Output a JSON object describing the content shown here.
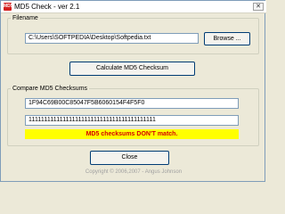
{
  "window": {
    "title": "MD5 Check - ver 2.1",
    "icon_label": "MD5",
    "close_glyph": "✕"
  },
  "filename_group": {
    "legend": "Filename",
    "path_value": "C:\\Users\\SOFTPEDIA\\Desktop\\Softpedia.txt",
    "browse_label": "Browse ..."
  },
  "calculate_label": "Calculate MD5 Checksum",
  "compare_group": {
    "legend": "Compare MD5 Checksums",
    "computed_hash": "1F94C69B00C85047F5B6060154F4F5F0",
    "compare_value": "11111111111111111111111111111111111111111",
    "status_text": "MD5 checksums DON'T match.",
    "status_bg": "#ffff00",
    "status_color": "#d40000"
  },
  "close_label": "Close",
  "copyright": "Copyright © 2006,2007 - Angus Johnson"
}
